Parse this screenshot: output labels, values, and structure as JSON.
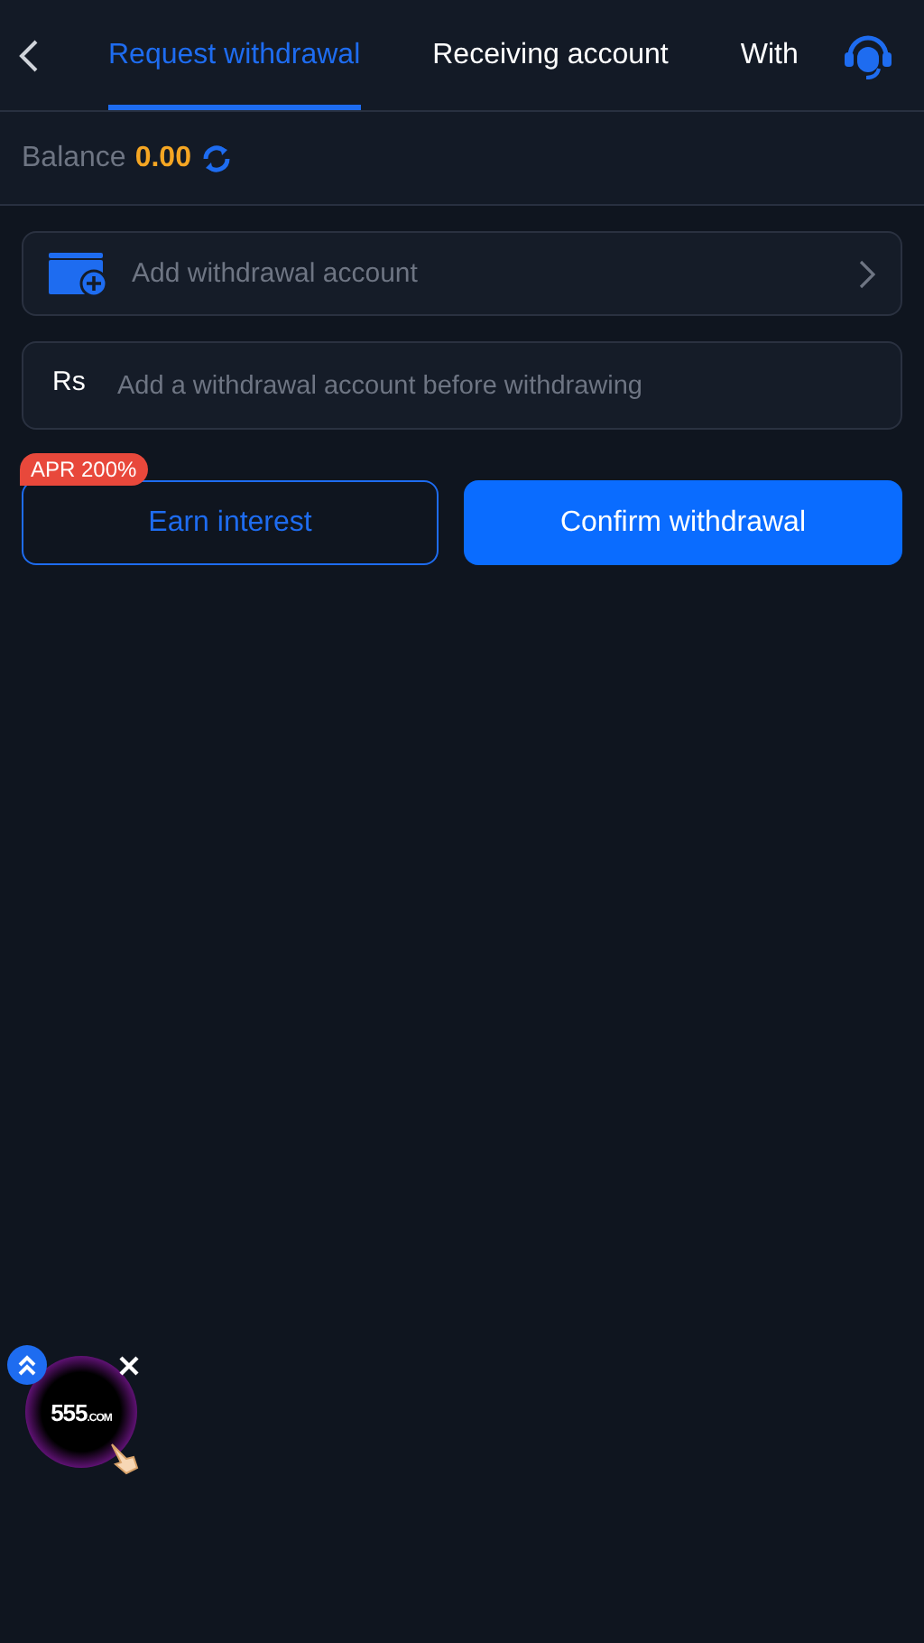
{
  "tabs": [
    {
      "label": "Request withdrawal",
      "selected": true
    },
    {
      "label": "Receiving account",
      "selected": false
    },
    {
      "label": "With",
      "selected": false
    }
  ],
  "balance": {
    "label": "Balance",
    "amount": "0.00"
  },
  "account_row": {
    "label": "Add withdrawal account"
  },
  "amount_field": {
    "currency": "Rs",
    "placeholder": "Add a withdrawal account before withdrawing"
  },
  "earn_button": {
    "label": "Earn interest",
    "badge": "APR 200%"
  },
  "confirm_button": {
    "label": "Confirm withdrawal"
  },
  "floating_widget": {
    "logo_text": "555",
    "logo_suffix": ".COM"
  }
}
